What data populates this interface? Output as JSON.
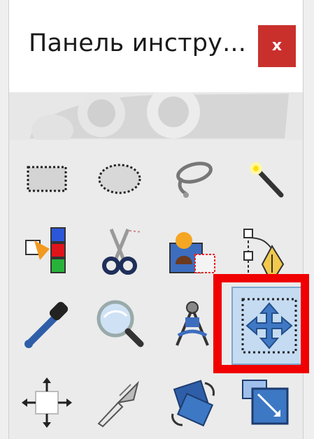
{
  "window": {
    "title": "Панель инстру...",
    "close_label": "x"
  },
  "colors": {
    "close_button": "#c9302c",
    "active_tool_bg": "#c4dbf1",
    "highlight_frame": "#f00000"
  },
  "tools": [
    {
      "icon": "rect-select-icon",
      "active": false
    },
    {
      "icon": "ellipse-select-icon",
      "active": false
    },
    {
      "icon": "free-select-lasso-icon",
      "active": false
    },
    {
      "icon": "fuzzy-select-wand-icon",
      "active": false
    },
    {
      "icon": "select-by-color-icon",
      "active": false
    },
    {
      "icon": "scissors-select-icon",
      "active": false
    },
    {
      "icon": "foreground-select-icon",
      "active": false
    },
    {
      "icon": "paths-pen-icon",
      "active": false
    },
    {
      "icon": "color-picker-icon",
      "active": false
    },
    {
      "icon": "magnify-icon",
      "active": false
    },
    {
      "icon": "measure-compass-icon",
      "active": false
    },
    {
      "icon": "move-icon",
      "active": true
    },
    {
      "icon": "alignment-icon",
      "active": false
    },
    {
      "icon": "crop-knife-icon",
      "active": false
    },
    {
      "icon": "rotate-icon",
      "active": false
    },
    {
      "icon": "scale-icon",
      "active": false
    }
  ]
}
